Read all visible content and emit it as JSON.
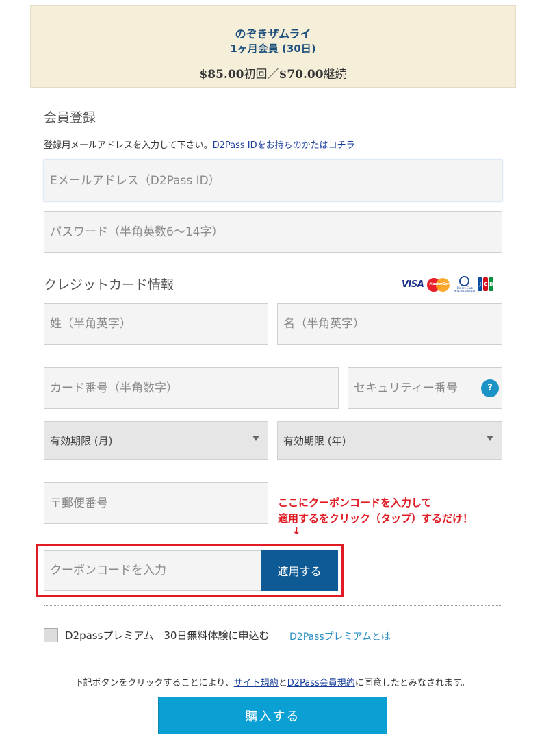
{
  "plan": {
    "name": "のぞきザムライ",
    "term": "1ヶ月会員 (30日)",
    "price_first": "$85.00",
    "price_first_suffix": "初回／",
    "price_renew": "$70.00",
    "price_renew_suffix": "継続"
  },
  "registration": {
    "title": "会員登録",
    "help_text": "登録用メールアドレスを入力して下さい。",
    "help_link": "D2Pass IDをお持ちのかたはコチラ",
    "email_placeholder": "Eメールアドレス（D2Pass ID）",
    "password_placeholder": "パスワード（半角英数6～14字）"
  },
  "credit_card": {
    "title": "クレジットカード情報",
    "logos": {
      "visa": "VISA",
      "mastercard": "MasterCard",
      "diners": "Diners Club INTERNATIONAL",
      "jcb": [
        "J",
        "C",
        "B"
      ]
    },
    "last_name_placeholder": "姓（半角英字）",
    "first_name_placeholder": "名（半角英字）",
    "card_number_placeholder": "カード番号（半角数字）",
    "security_code_placeholder": "セキュリティー番号",
    "help_icon": "?",
    "exp_month": "有効期限 (月)",
    "exp_year": "有効期限 (年)",
    "postal_placeholder": "〒郵便番号"
  },
  "coupon": {
    "note_line1": "ここにクーポンコードを入力して",
    "note_line2": "適用するをクリック（タップ）するだけ！",
    "note_arrow": "↓",
    "placeholder": "クーポンコードを入力",
    "apply_label": "適用する"
  },
  "premium": {
    "label": "D2passプレミアム　30日無料体験に申込む",
    "link": "D2Passプレミアムとは"
  },
  "agreement": {
    "prefix": "下記ボタンをクリックすることにより、",
    "link1": "サイト規約",
    "mid": "と",
    "link2": "D2Pass会員規約",
    "suffix": "に同意したとみなされます。"
  },
  "buy_button": "購入する",
  "colors": {
    "plan_bg": "#f5efda",
    "plan_text": "#1d4f7c",
    "apply_button": "#0d5a94",
    "buy_button": "#0ba0d4",
    "coupon_highlight": "#e01b24",
    "link": "#1a3e9c"
  }
}
